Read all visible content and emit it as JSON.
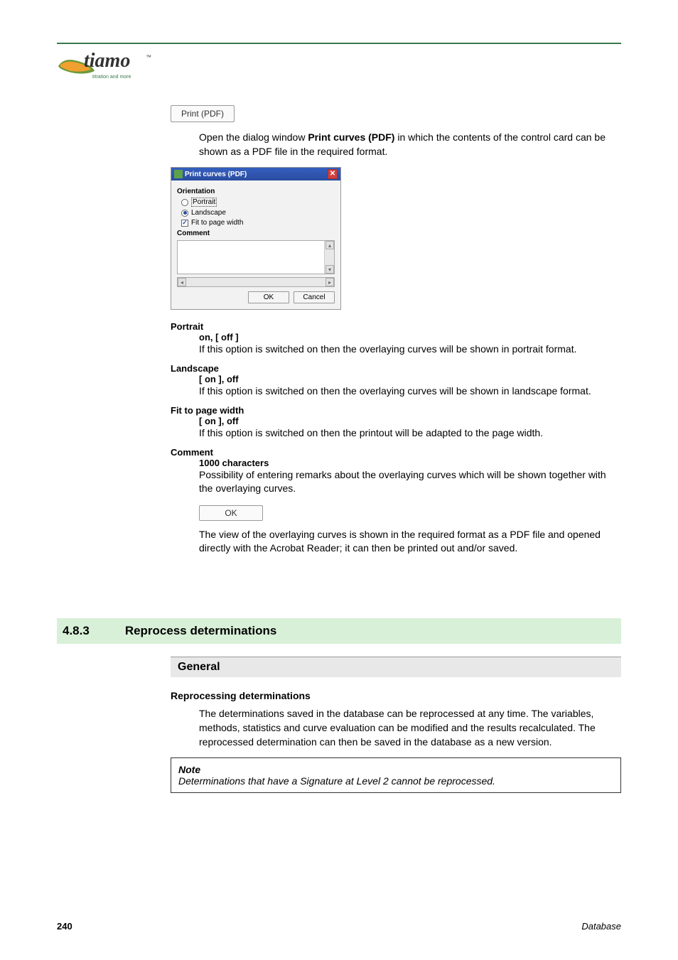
{
  "logo": {
    "name": "tiamo",
    "tm": "™",
    "tagline": "titration and more"
  },
  "print_button": "Print (PDF)",
  "intro_para_pre": "Open the dialog window ",
  "intro_para_bold": "Print curves (PDF)",
  "intro_para_post": " in which the contents of the control card can be shown as a PDF file in the required format.",
  "dialog": {
    "title": "Print curves (PDF)",
    "orientation_label": "Orientation",
    "portrait": "Portrait",
    "landscape": "Landscape",
    "fit": "Fit to page width",
    "comment_label": "Comment",
    "ok": "OK",
    "cancel": "Cancel"
  },
  "options": {
    "portrait": {
      "title": "Portrait",
      "vals": "on, [ off ]",
      "desc": "If this option is switched on then the overlaying curves will be shown in portrait format."
    },
    "landscape": {
      "title": "Landscape",
      "vals": "[ on ], off",
      "desc": "If this option is switched on then the overlaying curves will be shown in landscape format."
    },
    "fit": {
      "title": "Fit to page width",
      "vals": "[ on ], off",
      "desc": "If this option is switched on then the printout will be adapted to the page width."
    },
    "comment": {
      "title": "Comment",
      "vals": "1000 characters",
      "desc": "Possibility of entering remarks about the overlaying curves which will be shown together with the overlaying curves."
    }
  },
  "ok_button": "OK",
  "ok_para": "The view of the overlaying curves is shown in the required format as a PDF file and opened directly with the Acrobat Reader; it can then be printed out and/or saved.",
  "section": {
    "num": "4.8.3",
    "title": "Reprocess determinations"
  },
  "general": "General",
  "repro_heading": "Reprocessing determinations",
  "repro_para": "The determinations saved in the database can be reprocessed at any time. The variables, methods, statistics and curve evaluation can be modified and the results recalculated. The reprocessed determination can then be saved in the database as a new version.",
  "note": {
    "title": "Note",
    "text": "Determinations that have a Signature at Level 2 cannot be reprocessed."
  },
  "footer": {
    "page": "240",
    "chapter": "Database"
  }
}
